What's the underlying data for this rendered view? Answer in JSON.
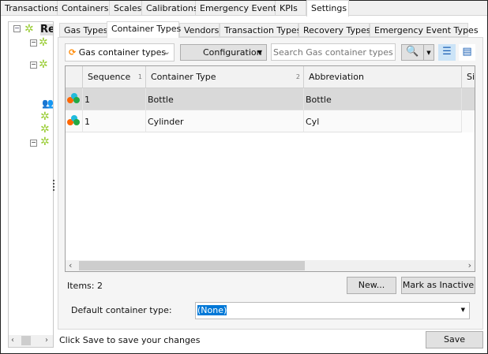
{
  "top_tabs": [
    "Transactions",
    "Containers",
    "Scales",
    "Calibrations",
    "Emergency Events",
    "KPIs",
    "Settings"
  ],
  "active_top_tab": "Settings",
  "tree": {
    "root_label": "Re"
  },
  "inner_tabs": [
    "Gas Types",
    "Container Types",
    "Vendors",
    "Transaction Types",
    "Recovery Types",
    "Emergency Event Types"
  ],
  "active_inner_tab": "Container Types",
  "toolbar": {
    "view_select": "Gas container types",
    "configuration": "Configuration",
    "search_placeholder": "Search Gas container types at y"
  },
  "grid": {
    "columns": [
      {
        "label": "Sequence",
        "sort": "1"
      },
      {
        "label": "Container Type",
        "sort": "2"
      },
      {
        "label": "Abbreviation",
        "sort": ""
      },
      {
        "label": "Sit",
        "sort": ""
      }
    ],
    "rows": [
      {
        "sequence": "1",
        "type": "Bottle",
        "abbr": "Bottle",
        "selected": true
      },
      {
        "sequence": "1",
        "type": "Cylinder",
        "abbr": "Cyl",
        "selected": false
      }
    ]
  },
  "items_label": "Items: 2",
  "new_button": "New...",
  "inactive_button": "Mark as Inactive",
  "default_label": "Default container type:",
  "default_value": "(None)",
  "status_text": "Click Save to save your changes",
  "save_button": "Save"
}
